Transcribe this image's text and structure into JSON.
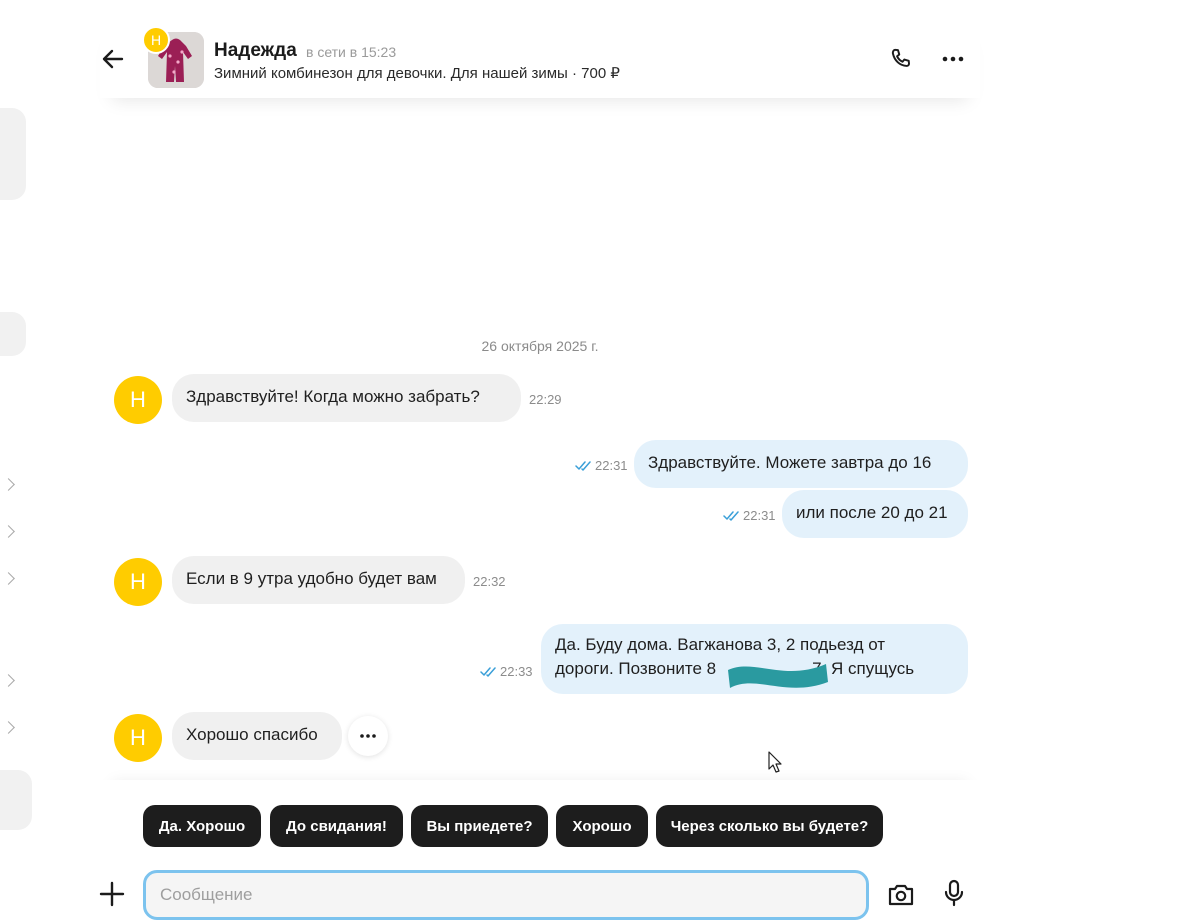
{
  "header": {
    "contact_name": "Надежда",
    "status": "в сети в 15:23",
    "avatar_letter": "Н",
    "item_title": "Зимний комбинезон для девочки. Для нашей зимы · 700 ₽",
    "icons": {
      "back": "arrow-left-icon",
      "phone": "phone-icon",
      "more": "more-horizontal-icon"
    }
  },
  "date_separator": "26 октября 2025 г.",
  "messages": [
    {
      "direction": "incoming",
      "text": "Здравствуйте! Когда можно забрать?",
      "time": "22:29"
    },
    {
      "direction": "outgoing",
      "text": "Здравствуйте. Можете завтра до 16",
      "time": "22:31",
      "read": true
    },
    {
      "direction": "outgoing",
      "text": "или после 20 до 21",
      "time": "22:31",
      "read": true
    },
    {
      "direction": "incoming",
      "text": "Если в 9 утра удобно будет вам",
      "time": "22:32"
    },
    {
      "direction": "outgoing",
      "line1": "Да. Буду дома. Вагжанова 3, 2 подьезд от",
      "line2_prefix": "дороги. Позвоните 8",
      "line2_suffix": "7. Я спущусь",
      "time": "22:33",
      "read": true
    },
    {
      "direction": "incoming",
      "text": "Хорошо спасибо",
      "time": ""
    }
  ],
  "quick_replies": [
    "Да. Хорошо",
    "До свидания!",
    "Вы приедете?",
    "Хорошо",
    "Через сколько вы будете?"
  ],
  "composer": {
    "placeholder": "Сообщение",
    "value": "",
    "icons": {
      "attach": "plus-icon",
      "camera": "camera-icon",
      "mic": "microphone-icon"
    }
  },
  "colors": {
    "avatar": "#ffcc00",
    "incoming_bubble": "#f0f0f0",
    "outgoing_bubble": "#e3f1fb",
    "read_check": "#3a9fd8",
    "chip_bg": "#1d1d1d",
    "input_border": "#7cc3ee",
    "redaction": "#2a9aa0"
  }
}
